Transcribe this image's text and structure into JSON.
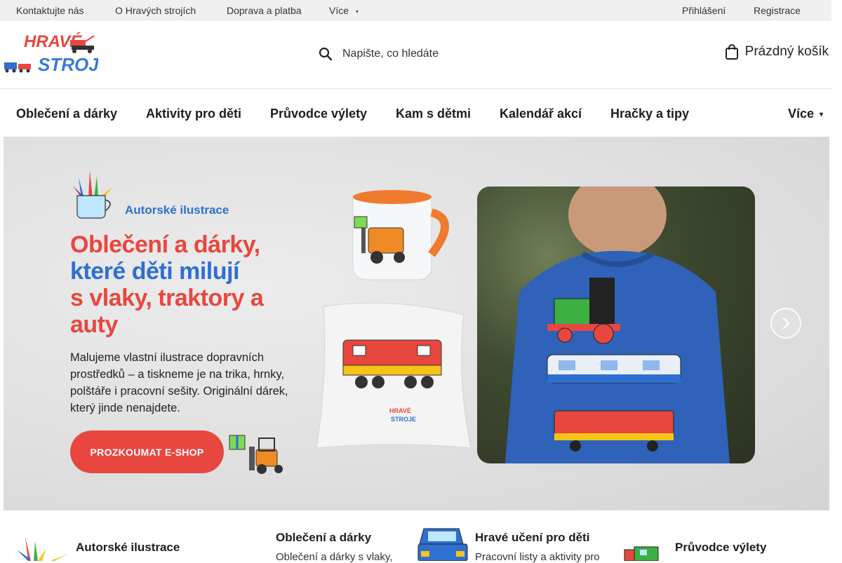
{
  "topbar": {
    "contact": "Kontaktujte nás",
    "about": "O Hravých strojích",
    "shipping": "Doprava a platba",
    "more": "Více",
    "login": "Přihlášení",
    "register": "Registrace"
  },
  "logo": {
    "line1": "HRAVÉ",
    "line2": "STROJE"
  },
  "search": {
    "placeholder": "Napište, co hledáte"
  },
  "cart": {
    "label": "Prázdný košík"
  },
  "nav": {
    "items": [
      "Oblečení a dárky",
      "Aktivity pro děti",
      "Průvodce výlety",
      "Kam s dětmi",
      "Kalendář akcí",
      "Hračky a tipy"
    ],
    "more": "Více"
  },
  "hero": {
    "illustrations_label": "Autorské ilustrace",
    "headline_1": "Oblečení a dárky,",
    "headline_2": "které děti milují",
    "headline_3": "s vlaky, traktory a",
    "headline_4": "auty",
    "subtext": "Malujeme vlastní ilustrace dopravních prostředků – a tiskneme je na trika, hrnky, polštáře i pracovní sešity. Originální dárek, který jinde nenajdete.",
    "cta": "PROZKOUMAT E-SHOP",
    "mini_logo_1": "HRAVÉ",
    "mini_logo_2": "STROJE"
  },
  "features": [
    {
      "title": "Autorské ilustrace",
      "desc": ""
    },
    {
      "title": "Oblečení a dárky",
      "desc": "Oblečení a dárky s vlaky,"
    },
    {
      "title": "Hravé učení pro děti",
      "desc": "Pracovní listy a aktivity pro"
    },
    {
      "title": "Průvodce výlety",
      "desc": ""
    }
  ],
  "colors": {
    "accent_red": "#e8473f",
    "accent_blue": "#2e6fd1",
    "topbar_bg": "#f0f0f0"
  },
  "icons": [
    "search-icon",
    "shopping-bag-icon",
    "chevron-down-icon",
    "arrow-right-icon",
    "pencil-cup-icon",
    "car-icon",
    "train-icon"
  ]
}
